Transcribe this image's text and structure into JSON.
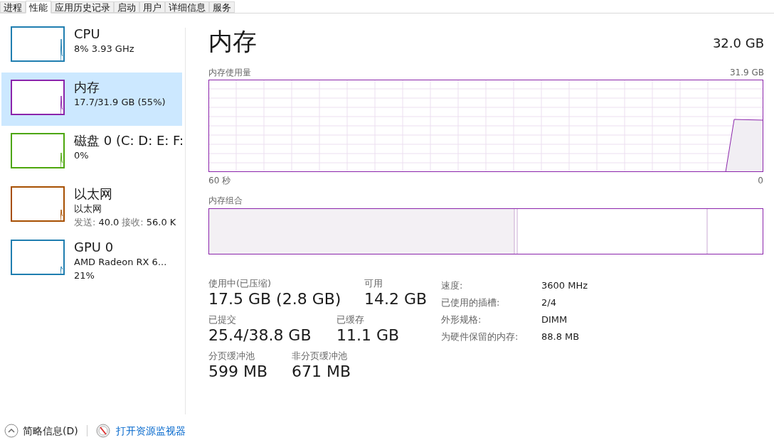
{
  "tabs": [
    {
      "label": "进程",
      "selected": false
    },
    {
      "label": "性能",
      "selected": true
    },
    {
      "label": "应用历史记录",
      "selected": false
    },
    {
      "label": "启动",
      "selected": false
    },
    {
      "label": "用户",
      "selected": false
    },
    {
      "label": "详细信息",
      "selected": false
    },
    {
      "label": "服务",
      "selected": false
    }
  ],
  "sidebar": {
    "items": [
      {
        "name": "CPU",
        "lines": [
          "8% 3.93 GHz"
        ],
        "color": "#1f7eb0",
        "selected": false
      },
      {
        "name": "内存",
        "lines": [
          "17.7/31.9 GB (55%)"
        ],
        "color": "#8b24ab",
        "selected": true
      },
      {
        "name": "磁盘 0 (C: D: E: F:",
        "lines": [
          "0%"
        ],
        "color": "#4da60c",
        "selected": false
      },
      {
        "name": "以太网",
        "lines": [
          "以太网"
        ],
        "rates": [
          {
            "label": "发送:",
            "value": "40.0"
          },
          {
            "label": "接收:",
            "value": "56.0 K"
          }
        ],
        "color": "#a74f01",
        "selected": false
      },
      {
        "name": "GPU 0",
        "lines": [
          "AMD Radeon RX 6...",
          "21%"
        ],
        "color": "#1f7eb0",
        "selected": false
      }
    ]
  },
  "main": {
    "title": "内存",
    "total": "32.0 GB",
    "usage_graph": {
      "label": "内存使用量",
      "max": "31.9 GB",
      "start": "60 秒",
      "end": "0"
    },
    "composition": {
      "label": "内存组合"
    },
    "stats": [
      [
        {
          "label": "使用中(已压缩)",
          "value": "17.5 GB (2.8 GB)"
        },
        {
          "label": "可用",
          "value": "14.2 GB"
        }
      ],
      [
        {
          "label": "已提交",
          "value": "25.4/38.8 GB"
        },
        {
          "label": "已缓存",
          "value": "11.1 GB"
        }
      ],
      [
        {
          "label": "分页缓冲池",
          "value": "599 MB"
        },
        {
          "label": "非分页缓冲池",
          "value": "671 MB"
        }
      ]
    ],
    "details": [
      {
        "label": "速度:",
        "value": "3600 MHz"
      },
      {
        "label": "已使用的插槽:",
        "value": "2/4"
      },
      {
        "label": "外形规格:",
        "value": "DIMM"
      },
      {
        "label": "为硬件保留的内存:",
        "value": "88.8 MB"
      }
    ]
  },
  "footer": {
    "summary": "简略信息(D)",
    "monitor_link": "打开资源监视器"
  }
}
